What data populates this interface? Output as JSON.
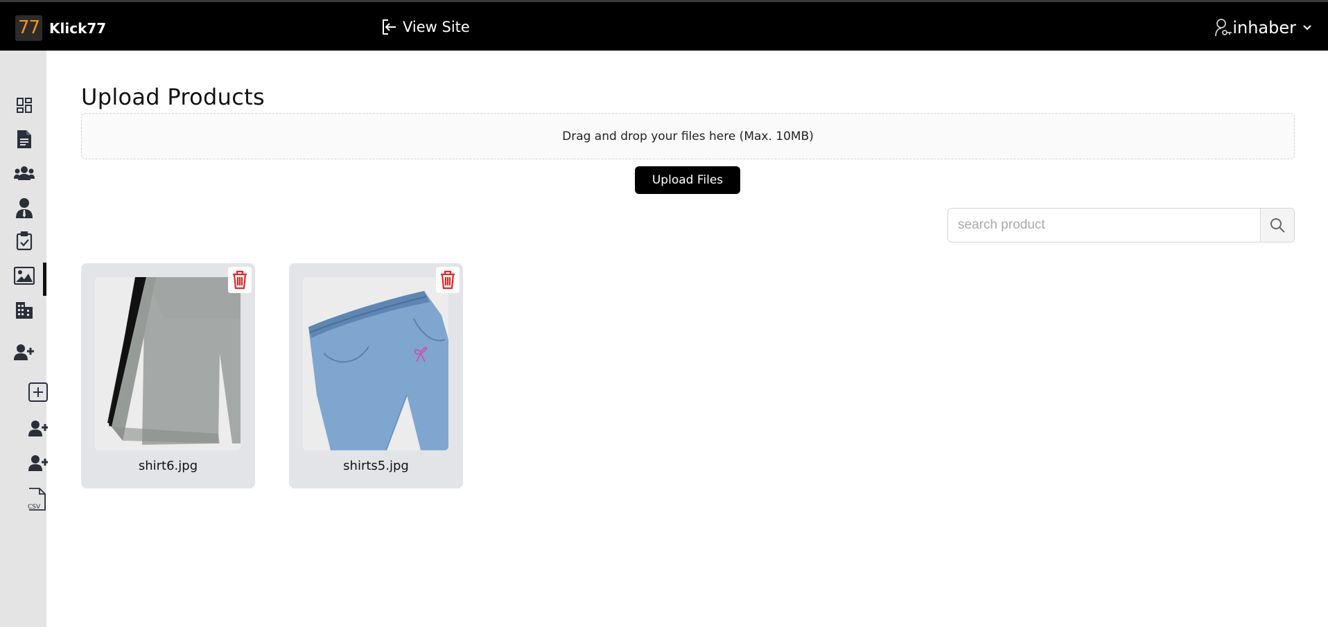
{
  "brand": {
    "logo_text": "77",
    "name": "Klick77",
    "logo_color": "#f7941d"
  },
  "header": {
    "view_site_label": "View Site",
    "view_site_icon": "sign-out-icon",
    "user_name": "inhaber",
    "user_icon": "user-key-icon",
    "dropdown_icon": "chevron-down-icon"
  },
  "sidebar": {
    "items": [
      {
        "icon": "dashboard-icon"
      },
      {
        "icon": "document-icon"
      },
      {
        "icon": "users-group-icon"
      },
      {
        "icon": "user-tie-icon"
      },
      {
        "icon": "clipboard-check-icon"
      },
      {
        "icon": "image-icon",
        "active": true
      },
      {
        "icon": "building-icon"
      },
      {
        "icon": "user-plus-icon"
      },
      {
        "icon": "plus-square-icon"
      },
      {
        "icon": "user-plus-icon"
      },
      {
        "icon": "user-plus-icon"
      },
      {
        "icon": "csv-file-icon",
        "label": "CSV"
      }
    ]
  },
  "main": {
    "title": "Upload Products",
    "dropzone_text": "Drag and drop your files here (Max. 10MB)",
    "upload_button": "Upload Files",
    "search": {
      "placeholder": "search product",
      "value": ""
    },
    "products": [
      {
        "filename": "shirt6.jpg"
      },
      {
        "filename": "shirts5.jpg"
      }
    ]
  },
  "colors": {
    "topbar": "#000000",
    "sidebar": "#e4e4e4",
    "delete": "#e02424",
    "card": "#e3e4e8"
  }
}
